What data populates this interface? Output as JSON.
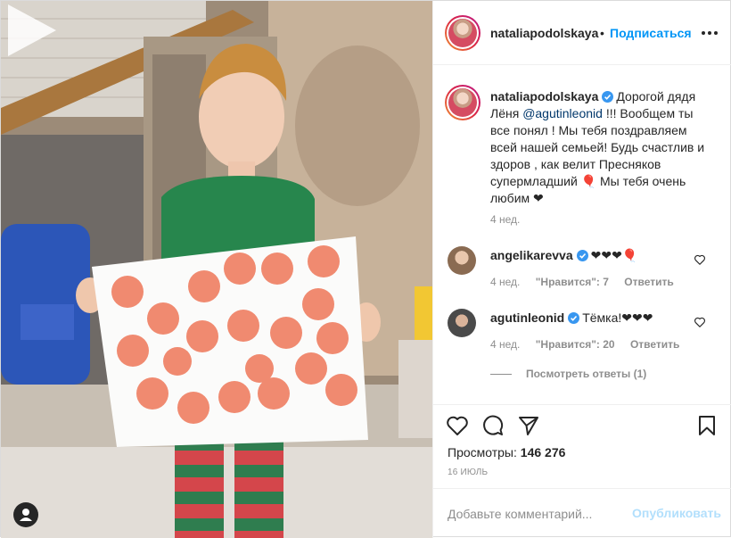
{
  "header": {
    "username": "nataliapodolskaya",
    "separator": "•",
    "follow_label": "Подписаться"
  },
  "caption": {
    "username": "nataliapodolskaya",
    "text_before": "Дорогой дядя Лёня",
    "mention": "@agutinleonid",
    "text_after": "!!! Вообщем ты все понял ! Мы тебя поздравляем всей нашей семьей! Будь счастлив и здоров , как велит Пресняков супермладший 🎈 Мы тебя очень любим ❤",
    "time": "4 нед."
  },
  "comments": [
    {
      "username": "angelikarevva",
      "text": "❤❤❤🎈",
      "time": "4 нед.",
      "likes": "\"Нравится\": 7",
      "reply_label": "Ответить"
    },
    {
      "username": "agutinleonid",
      "text": "Тёмка!❤❤❤",
      "time": "4 нед.",
      "likes": "\"Нравится\": 20",
      "reply_label": "Ответить"
    }
  ],
  "view_replies": "Посмотреть ответы (1)",
  "stats": {
    "views_label": "Просмотры:",
    "views_value": "146 276",
    "date": "16 июль"
  },
  "add_comment": {
    "placeholder": "Добавьте комментарий...",
    "publish_label": "Опубликовать"
  },
  "colors": {
    "link_blue": "#0095f6",
    "publish_disabled": "#b2dffc",
    "verified_blue": "#3897f0",
    "meta_gray": "#8e8e8e"
  },
  "icons": [
    "play-icon",
    "user-tag-icon",
    "more-options-icon",
    "verified-icon",
    "heart-icon",
    "comment-icon",
    "share-icon",
    "bookmark-icon"
  ]
}
